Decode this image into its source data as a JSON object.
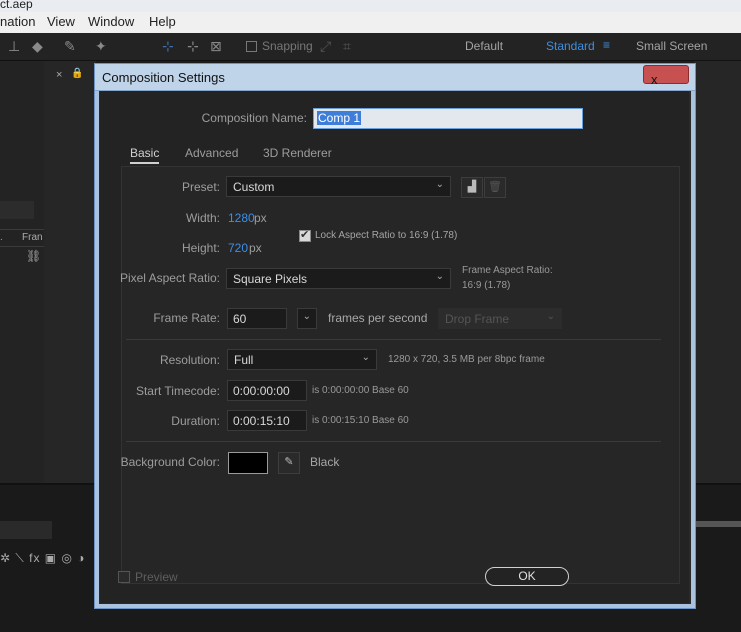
{
  "window": {
    "title_fragment": "ct.aep"
  },
  "menu": [
    "nation",
    "View",
    "Window",
    "Help"
  ],
  "toolbar": {
    "snapping_label": "Snapping",
    "workspaces": [
      "Default",
      "Standard",
      "Small Screen"
    ],
    "active_workspace": "Standard",
    "accent": "#3f8fe0"
  },
  "left_panel": {
    "col_a": ".",
    "col_b": "Fran"
  },
  "dialog": {
    "title": "Composition Settings",
    "close_label": "x",
    "comp_name_label": "Composition Name:",
    "comp_name_value": "Comp 1",
    "tabs": [
      "Basic",
      "Advanced",
      "3D Renderer"
    ],
    "active_tab": "Basic",
    "preset_label": "Preset:",
    "preset_value": "Custom",
    "width_label": "Width:",
    "width_value": "1280",
    "height_label": "Height:",
    "height_value": "720",
    "px_unit": "px",
    "lock_aspect_label": "Lock Aspect Ratio to 16:9 (1.78)",
    "lock_aspect_checked": true,
    "pixel_aspect_label": "Pixel Aspect Ratio:",
    "pixel_aspect_value": "Square Pixels",
    "frame_aspect_label": "Frame Aspect Ratio:",
    "frame_aspect_value": "16:9 (1.78)",
    "frame_rate_label": "Frame Rate:",
    "frame_rate_value": "60",
    "frames_per_second_label": "frames per second",
    "drop_frame_label": "Drop Frame",
    "resolution_label": "Resolution:",
    "resolution_value": "Full",
    "resolution_info": "1280 x 720, 3.5 MB per 8bpc frame",
    "start_timecode_label": "Start Timecode:",
    "start_timecode_value": "0:00:00:00",
    "start_timecode_info": "is 0:00:00:00  Base 60",
    "duration_label": "Duration:",
    "duration_value": "0:00:15:10",
    "duration_info": "is 0:00:15:10  Base 60",
    "bg_color_label": "Background Color:",
    "bg_color_name": "Black",
    "bg_color_hex": "#000000",
    "preview_label": "Preview",
    "ok_label": "OK"
  }
}
